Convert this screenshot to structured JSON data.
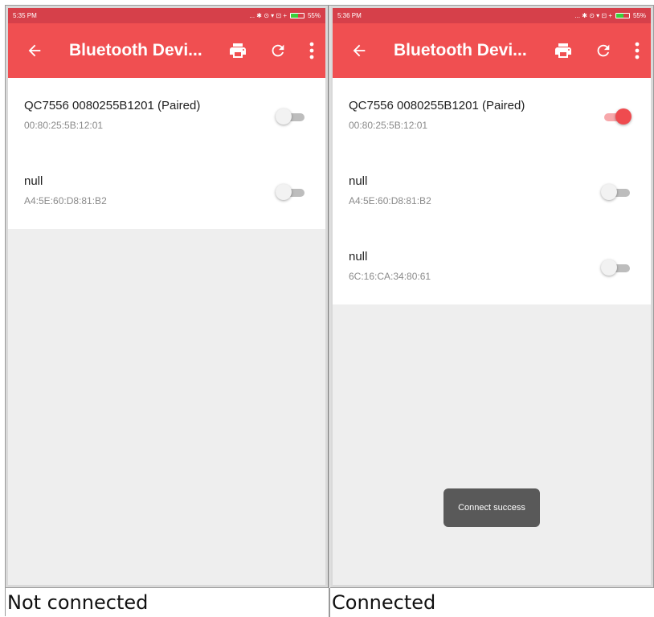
{
  "app": {
    "title": "Bluetooth Devi...",
    "accent_color": "#f04f51",
    "statusbar_color": "#d6404a",
    "icons": [
      "arrow-back-icon",
      "print-icon",
      "refresh-icon",
      "more-vert-icon"
    ]
  },
  "panels": [
    {
      "caption": "Not connected",
      "status": {
        "time": "5:35 PM",
        "icons": "... ✱ ⊙ ▾ ⊡ +",
        "battery": "55%",
        "battery_level": 0.55
      },
      "devices": [
        {
          "name": "QC7556 0080255B1201 (Paired)",
          "address": "00:80:25:5B:12:01",
          "connected": false
        },
        {
          "name": "null",
          "address": "A4:5E:60:D8:81:B2",
          "connected": false
        }
      ],
      "toast": ""
    },
    {
      "caption": "Connected",
      "status": {
        "time": "5:36 PM",
        "icons": "... ✱ ⊙ ▾ ⊡ +",
        "battery": "55%",
        "battery_level": 0.55
      },
      "devices": [
        {
          "name": "QC7556 0080255B1201 (Paired)",
          "address": "00:80:25:5B:12:01",
          "connected": true
        },
        {
          "name": "null",
          "address": "A4:5E:60:D8:81:B2",
          "connected": false
        },
        {
          "name": "null",
          "address": "6C:16:CA:34:80:61",
          "connected": false
        }
      ],
      "toast": "Connect success"
    }
  ]
}
